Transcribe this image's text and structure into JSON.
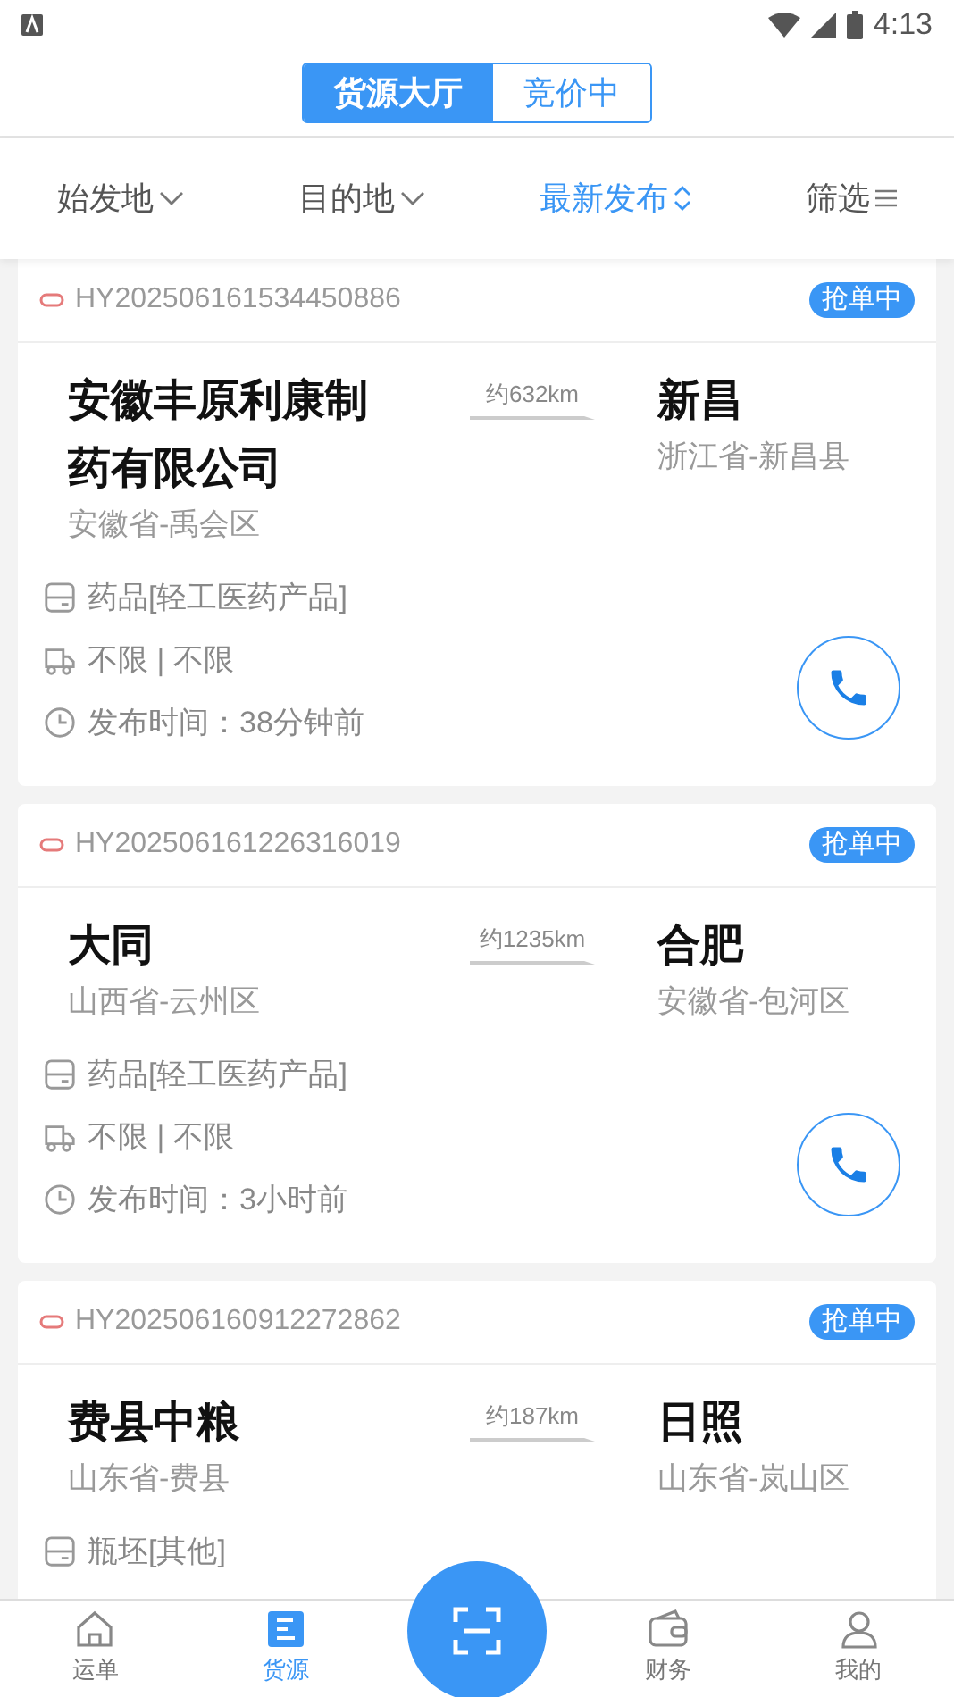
{
  "status_bar": {
    "time": "4:13"
  },
  "segments": [
    {
      "label": "货源大厅",
      "selected": true
    },
    {
      "label": "竞价中",
      "selected": false
    }
  ],
  "filters": [
    {
      "label": "始发地",
      "kind": "dropdown",
      "selected": false
    },
    {
      "label": "目的地",
      "kind": "dropdown",
      "selected": false
    },
    {
      "label": "最新发布",
      "kind": "sort",
      "selected": true
    },
    {
      "label": "筛选",
      "kind": "menu",
      "selected": false
    }
  ],
  "cards": [
    {
      "order_no": "HY202506161534450886",
      "badge": "抢单中",
      "origin": "安徽丰原利康制药有限公司",
      "origin_area": "安徽省-禹会区",
      "distance": "约632km",
      "destination": "新昌",
      "destination_area": "浙江省-新昌县",
      "rows": [
        {
          "kind": "cargo",
          "text": "药品[轻工医药产品]"
        },
        {
          "kind": "vehicle",
          "text": "不限 | 不限"
        },
        {
          "kind": "time",
          "text": "发布时间：38分钟前"
        }
      ],
      "call_button": true
    },
    {
      "order_no": "HY202506161226316019",
      "badge": "抢单中",
      "origin": "大同",
      "origin_area": "山西省-云州区",
      "distance": "约1235km",
      "destination": "合肥",
      "destination_area": "安徽省-包河区",
      "rows": [
        {
          "kind": "cargo",
          "text": "药品[轻工医药产品]"
        },
        {
          "kind": "vehicle",
          "text": "不限 | 不限"
        },
        {
          "kind": "time",
          "text": "发布时间：3小时前"
        }
      ],
      "call_button": true
    },
    {
      "order_no": "HY202506160912272862",
      "badge": "抢单中",
      "origin": "费县中粮",
      "origin_area": "山东省-费县",
      "distance": "约187km",
      "destination": "日照",
      "destination_area": "山东省-岚山区",
      "rows": [
        {
          "kind": "cargo",
          "text": "瓶坯[其他]"
        }
      ],
      "call_button": false
    }
  ],
  "nav": [
    {
      "label": "运单",
      "kind": "home",
      "selected": false
    },
    {
      "label": "货源",
      "kind": "list",
      "selected": true
    },
    {
      "kind": "scan",
      "selected": false
    },
    {
      "label": "财务",
      "kind": "wallet",
      "selected": false
    },
    {
      "label": "我的",
      "kind": "user",
      "selected": false
    }
  ]
}
